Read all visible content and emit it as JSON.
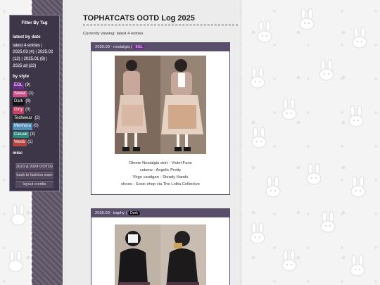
{
  "sidebar": {
    "title": "Filter By Tag",
    "date_heading": "latest by date",
    "date_links": [
      "latest 4 entries",
      "2025.03 (4)",
      "2025.02 (12)",
      "2025.01 (6)",
      "2025 all (22)"
    ],
    "style_heading": "by style",
    "style_tags": [
      {
        "label": "EGL",
        "count": "(9)",
        "color": "#6c2d8a"
      },
      {
        "label": "Sweet",
        "count": "(1)",
        "color": "#c94f86"
      },
      {
        "label": "Dark",
        "count": "(9)",
        "color": "#151218"
      },
      {
        "label": "Girly",
        "count": "(0)",
        "color": "#c64060"
      },
      {
        "label": "Techwear",
        "count": "(2)",
        "color": "#2a2a2a"
      },
      {
        "label": "Menhera",
        "count": "(0)",
        "color": "#4f8fb8"
      },
      {
        "label": "Casual",
        "count": "(3)",
        "color": "#2d8a7a"
      },
      {
        "label": "Weeb",
        "count": "(1)",
        "color": "#b24442"
      }
    ],
    "misc_heading": "misc",
    "buttons": [
      "2023 & 2024 OOTDs",
      "back to fashion main",
      "layout credits"
    ]
  },
  "main": {
    "title": "TOPHATCATS OOTD Log 2025",
    "viewing": "Currently viewing: latest 4 entries"
  },
  "entries": [
    {
      "header": "2025.03 - nostalgia |",
      "tag": "EGL",
      "tag_color": "#6c2d8a",
      "caption_lines": [
        "Otome Nostalgia skirt - Violet Fane",
        "cutsew - Angelic Pretty",
        "Virgo cardigan - Steady Hands",
        "shoes - Sosic shop via The Lolita Collective"
      ]
    },
    {
      "header": "2025.03 - baphy |",
      "tag": "Dark",
      "tag_color": "#151218"
    }
  ],
  "colors": {
    "sidebar_bg": "#3d3548",
    "card_header": "#5a4f6b",
    "page_bg": "#f4f4f4"
  }
}
